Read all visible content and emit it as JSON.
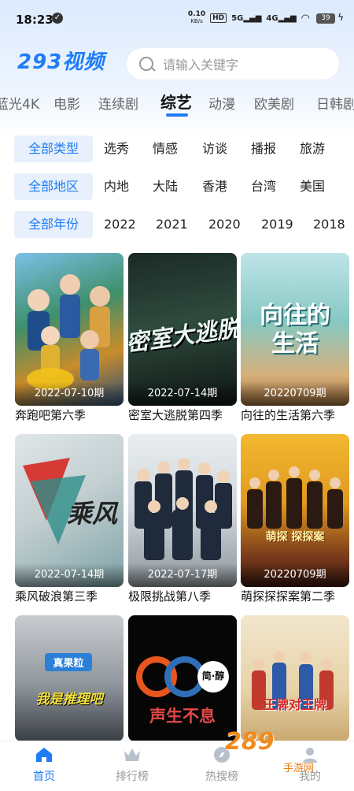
{
  "status_bar": {
    "time": "18:23",
    "net_speed_top": "0.10",
    "net_speed_bottom": "KB/s",
    "hd": "HD",
    "sig1": "5G",
    "sig2": "4G",
    "battery": "39"
  },
  "app": {
    "logo": "293视频",
    "search_placeholder": "请输入关键字"
  },
  "tabs": [
    "蓝光4K",
    "电影",
    "连续剧",
    "综艺",
    "动漫",
    "欧美剧",
    "日韩剧"
  ],
  "active_tab": "综艺",
  "filters": {
    "type": {
      "label": "全部类型",
      "options": [
        "选秀",
        "情感",
        "访谈",
        "播报",
        "旅游"
      ]
    },
    "region": {
      "label": "全部地区",
      "options": [
        "内地",
        "大陆",
        "香港",
        "台湾",
        "美国"
      ]
    },
    "year": {
      "label": "全部年份",
      "options": [
        "2022",
        "2021",
        "2020",
        "2019",
        "2018"
      ]
    }
  },
  "cards": [
    {
      "title": "奔跑吧第六季",
      "date": "2022-07-10期"
    },
    {
      "title": "密室大逃脱第四季",
      "date": "2022-07-14期"
    },
    {
      "title": "向往的生活第六季",
      "date": "20220709期"
    },
    {
      "title": "乘风破浪第三季",
      "date": "2022-07-14期"
    },
    {
      "title": "极限挑战第八季",
      "date": "2022-07-17期"
    },
    {
      "title": "萌探探探案第二季",
      "date": "20220709期"
    },
    {
      "title": "",
      "date": ""
    },
    {
      "title": "",
      "date": ""
    },
    {
      "title": "",
      "date": ""
    }
  ],
  "poster_art": {
    "p2": "密室大逃脱",
    "p3": "向往的生活",
    "p4": "乘风",
    "p6": "萌探 探探案",
    "p7a": "真果粒",
    "p7b": "我是推理吧",
    "p8a": "简·醇",
    "p8b": "声生不息",
    "p9": "王牌对王牌"
  },
  "bottom_nav": [
    {
      "label": "首页",
      "icon": "home-icon",
      "active": true
    },
    {
      "label": "排行榜",
      "icon": "crown-icon",
      "active": false
    },
    {
      "label": "热搜榜",
      "icon": "compass-icon",
      "active": false
    },
    {
      "label": "我的",
      "icon": "user-icon",
      "active": false
    }
  ],
  "watermark": {
    "text": "289",
    "sub": "手游网"
  },
  "colors": {
    "accent": "#1e7cf5",
    "chip_bg": "#e7f0fc"
  }
}
